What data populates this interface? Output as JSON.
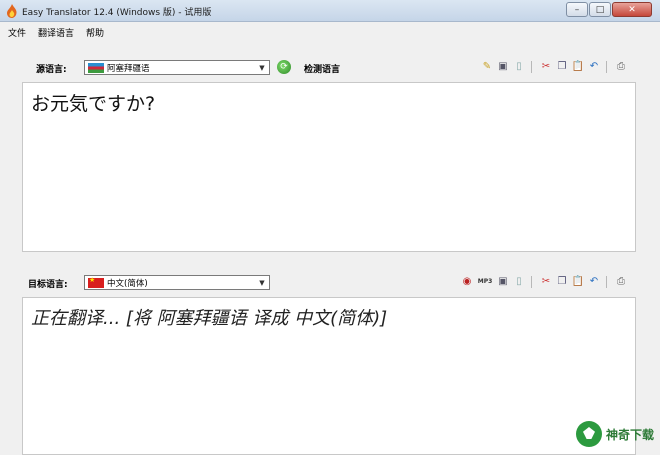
{
  "window": {
    "title": "Easy Translator 12.4 (Windows 版) - 试用版",
    "controls": {
      "minimize": "–",
      "maximize": "□",
      "close": "✕"
    }
  },
  "menu": [
    "文件",
    "翻译语言",
    "帮助"
  ],
  "source": {
    "label": "源语言:",
    "language": "阿塞拜疆语",
    "flag_icon": "flag-azerbaijan",
    "detect_label": "检测语言",
    "text": "お元気ですか?",
    "toolbar_icons": [
      "translate-icon",
      "save-icon",
      "new-icon",
      "cut-icon",
      "copy-icon",
      "paste-icon",
      "undo-icon",
      "print-icon"
    ]
  },
  "target": {
    "label": "目标语言:",
    "language": "中文(简体)",
    "flag_icon": "flag-china",
    "text": "正在翻译... [将 阿塞拜疆语 译成 中文(简体)]",
    "mp3_label": "MP3",
    "toolbar_icons": [
      "speaker-icon",
      "mp3-icon",
      "save-icon",
      "new-icon",
      "cut-icon",
      "copy-icon",
      "paste-icon",
      "undo-icon",
      "print-icon"
    ]
  },
  "watermark": {
    "text": "神奇下载"
  },
  "colors": {
    "titlebar": "#c5d5e8",
    "panel": "#f0f0f0",
    "close_button": "#c5473a",
    "watermark": "#2c7a36"
  }
}
